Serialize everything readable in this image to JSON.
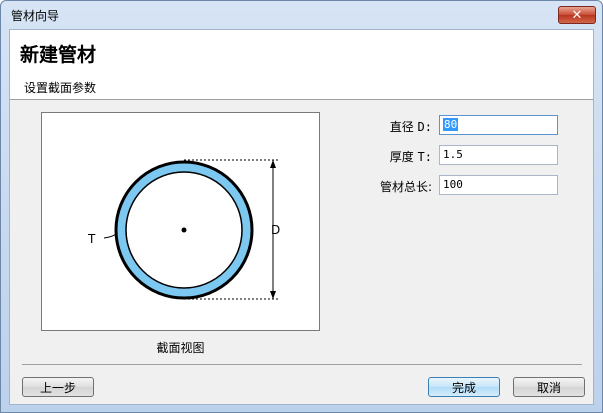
{
  "window": {
    "title": "管材向导",
    "close_glyph": "✕"
  },
  "header": {
    "title": "新建管材",
    "section_label": "设置截面参数"
  },
  "preview": {
    "caption": "截面视图",
    "thickness_label": "T",
    "diameter_label": "D",
    "ring_color": "#7dc8f0"
  },
  "fields": {
    "diameter": {
      "label_cn": "直径",
      "label_sym": "D:",
      "value": "80"
    },
    "thickness": {
      "label_cn": "厚度",
      "label_sym": "T:",
      "value": "1.5"
    },
    "length": {
      "label": "管材总长:",
      "value": "100"
    }
  },
  "buttons": {
    "prev": "上一步",
    "finish": "完成",
    "cancel": "取消"
  }
}
